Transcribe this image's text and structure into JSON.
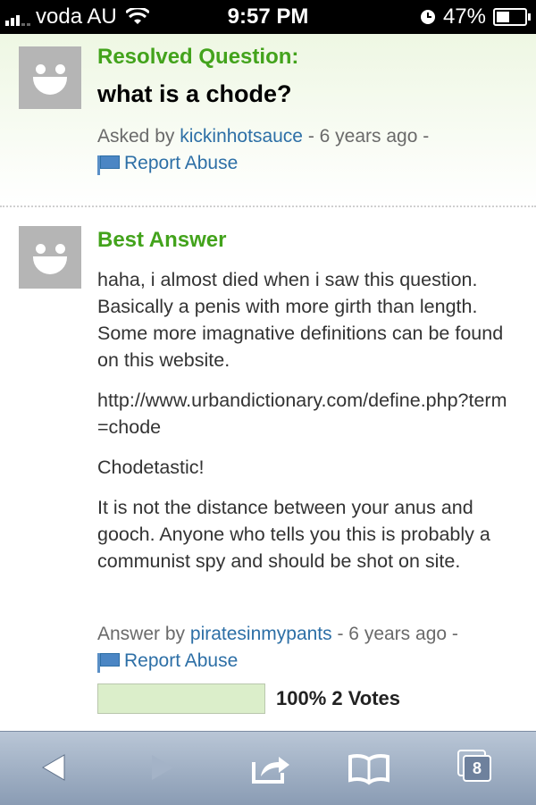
{
  "status_bar": {
    "carrier": "voda AU",
    "time": "9:57 PM",
    "battery": "47%",
    "battery_level": 0.47
  },
  "question": {
    "label": "Resolved Question:",
    "title": "what is a chode?",
    "asked_prefix": "Asked by",
    "user": "kickinhotsauce",
    "time_ago": "- 6 years ago -",
    "report": "Report Abuse"
  },
  "answer": {
    "label": "Best Answer",
    "paragraphs": [
      "haha, i almost died when i saw this question. Basically a penis with more girth than length. Some more imagnative definitions can be found on this website.",
      "http://www.urbandictionary.com/define.php?term=chode",
      "Chodetastic!",
      "It is not the distance between your anus and gooch. Anyone who tells you this is probably a communist spy and should be shot on site."
    ],
    "answered_prefix": "Answer by",
    "user": "piratesinmypants",
    "time_ago": "- 6 years ago -",
    "report": "Report Abuse",
    "votes_text": "100% 2 Votes",
    "vote_fraction": 1.0
  },
  "toolbar": {
    "tab_count": "8",
    "icons": [
      "back-arrow-icon",
      "forward-arrow-icon",
      "share-icon",
      "bookmarks-icon",
      "tabs-icon"
    ]
  },
  "colors": {
    "accent_green": "#43a31c",
    "link_blue": "#2d6fa6",
    "vote_fill": "#dbeeca"
  }
}
